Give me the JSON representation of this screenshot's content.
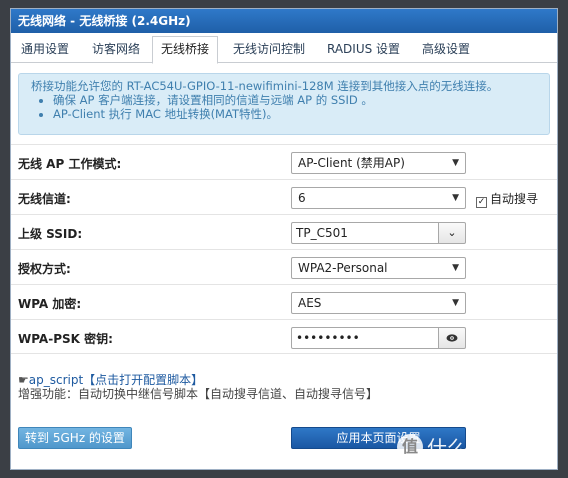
{
  "window": {
    "title": "无线网络 - 无线桥接 (2.4GHz)"
  },
  "tabs": [
    {
      "label": "通用设置"
    },
    {
      "label": "访客网络"
    },
    {
      "label": "无线桥接",
      "active": true
    },
    {
      "label": "无线访问控制"
    },
    {
      "label": "RADIUS 设置"
    },
    {
      "label": "高级设置"
    }
  ],
  "info": {
    "line1": "桥接功能允许您的 RT-AC54U-GPIO-11-newifimini-128M 连接到其他接入点的无线连接。",
    "bullet1": "确保 AP 客户端连接，请设置相同的信道与远端 AP 的 SSID 。",
    "bullet2": "AP-Client 执行 MAC 地址转换(MAT特性)。"
  },
  "form": {
    "mode": {
      "label": "无线 AP 工作模式:",
      "value": "AP-Client (禁用AP)"
    },
    "channel": {
      "label": "无线信道:",
      "value": "6",
      "auto_label": "自动搜寻",
      "auto_checked": true
    },
    "ssid": {
      "label": "上级 SSID:",
      "value": "TP_C501"
    },
    "auth": {
      "label": "授权方式:",
      "value": "WPA2-Personal"
    },
    "wpa_enc": {
      "label": "WPA 加密:",
      "value": "AES"
    },
    "psk": {
      "label": "WPA-PSK 密钥:",
      "value": "•••••••••"
    }
  },
  "script": {
    "link": "ap_script【点击打开配置脚本】",
    "desc": "增强功能：自动切换中继信号脚本【自动搜寻信道、自动搜寻信号】"
  },
  "buttons": {
    "switch_5g": "转到 5GHz 的设置",
    "apply": "应用本页面设置"
  },
  "watermark": {
    "text": "什么值得买",
    "logo": "值"
  },
  "colors": {
    "titlebar": "#1f5fa8",
    "info_bg": "#d9ecf7",
    "apply_button": "#1a57a3",
    "switch_button": "#4f97cb"
  }
}
